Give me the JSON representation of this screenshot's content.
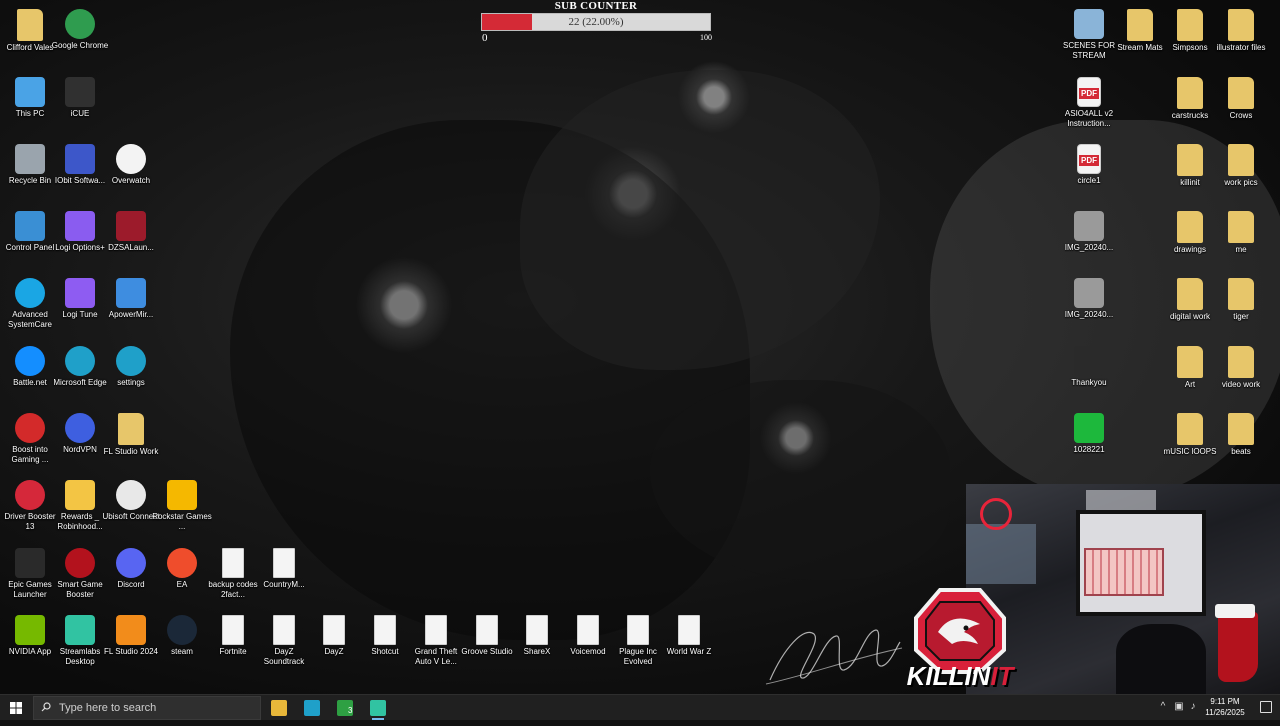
{
  "sub_counter": {
    "title": "SUB COUNTER",
    "current": 22,
    "progress_text": "22 (22.00%)",
    "progress_fraction": 0.22,
    "min_label": "0",
    "max_label": "100",
    "fill_color": "#d42a36"
  },
  "desktop": {
    "left_icons": [
      {
        "label": "Clifford Vales",
        "icon": "user-folder-icon",
        "color": "#e7c66a"
      },
      {
        "label": "Google Chrome",
        "icon": "chrome-icon",
        "color": "#2f9c4f"
      },
      {
        "label": "This PC",
        "icon": "computer-icon",
        "color": "#4aa3e6"
      },
      {
        "label": "iCUE",
        "icon": "icue-icon",
        "color": "#303030"
      },
      {
        "label": "Recycle Bin",
        "icon": "recycle-bin-icon",
        "color": "#9aa4ad"
      },
      {
        "label": "IObit Softwa...",
        "icon": "iobit-icon",
        "color": "#3d57c9"
      },
      {
        "label": "Overwatch",
        "icon": "overwatch-icon",
        "color": "#f3f3f3"
      },
      {
        "label": "Control Panel",
        "icon": "control-panel-icon",
        "color": "#3a8fd4"
      },
      {
        "label": "Logi Options+",
        "icon": "logi-options-icon",
        "color": "#8a5cf0"
      },
      {
        "label": "DZSALaun...",
        "icon": "dzsa-launcher-icon",
        "color": "#9c1b2b"
      },
      {
        "label": "Advanced SystemCare",
        "icon": "advanced-systemcare-icon",
        "color": "#1aa6e4"
      },
      {
        "label": "Logi Tune",
        "icon": "logi-tune-icon",
        "color": "#8e5cf2"
      },
      {
        "label": "ApowerMir...",
        "icon": "apowermirror-icon",
        "color": "#3e8de0"
      },
      {
        "label": "Battle.net",
        "icon": "battlenet-icon",
        "color": "#148eff"
      },
      {
        "label": "Microsoft Edge",
        "icon": "edge-icon",
        "color": "#1fa0c9"
      },
      {
        "label": "settings",
        "icon": "edge-settings-icon",
        "color": "#1fa0c9"
      },
      {
        "label": "Boost into Gaming ...",
        "icon": "boost-gaming-icon",
        "color": "#d32a2a"
      },
      {
        "label": "NordVPN",
        "icon": "nordvpn-icon",
        "color": "#3e5fe0"
      },
      {
        "label": "FL Studio Work",
        "icon": "folder-icon",
        "color": "#e7c66a"
      },
      {
        "label": "Driver Booster 13",
        "icon": "driver-booster-icon",
        "color": "#d5283a"
      },
      {
        "label": "Rewards _ Robinhood...",
        "icon": "star-icon",
        "color": "#f3c544"
      },
      {
        "label": "Ubisoft Connect",
        "icon": "ubisoft-icon",
        "color": "#e8e8e8"
      },
      {
        "label": "Rockstar Games ...",
        "icon": "rockstar-icon",
        "color": "#f5b800"
      },
      {
        "label": "Epic Games Launcher",
        "icon": "epic-games-icon",
        "color": "#2a2a2a"
      },
      {
        "label": "Smart Game Booster",
        "icon": "smart-game-booster-icon",
        "color": "#b3121d"
      },
      {
        "label": "Discord",
        "icon": "discord-icon",
        "color": "#5865f2"
      },
      {
        "label": "EA",
        "icon": "ea-icon",
        "color": "#ef4d2c"
      },
      {
        "label": "backup codes 2fact...",
        "icon": "document-icon",
        "color": "#f4f4f4"
      },
      {
        "label": "CountryM...",
        "icon": "document-icon",
        "color": "#f4f4f4"
      },
      {
        "label": "NVIDIA App",
        "icon": "nvidia-icon",
        "color": "#76b900"
      },
      {
        "label": "Streamlabs Desktop",
        "icon": "streamlabs-icon",
        "color": "#31c3a2"
      },
      {
        "label": "FL Studio 2024",
        "icon": "fl-studio-icon",
        "color": "#f28c1b"
      },
      {
        "label": "steam",
        "icon": "steam-icon",
        "color": "#1b2838"
      },
      {
        "label": "Fortnite",
        "icon": "document-icon",
        "color": "#f4f4f4"
      },
      {
        "label": "DayZ Soundtrack",
        "icon": "document-icon",
        "color": "#f4f4f4"
      },
      {
        "label": "DayZ",
        "icon": "document-icon",
        "color": "#f4f4f4"
      },
      {
        "label": "Shotcut",
        "icon": "document-icon",
        "color": "#f4f4f4"
      },
      {
        "label": "Grand Theft Auto V Le...",
        "icon": "document-icon",
        "color": "#f4f4f4"
      },
      {
        "label": "Groove Studio",
        "icon": "document-icon",
        "color": "#f4f4f4"
      },
      {
        "label": "ShareX",
        "icon": "document-icon",
        "color": "#f4f4f4"
      },
      {
        "label": "Voicemod",
        "icon": "document-icon",
        "color": "#f4f4f4"
      },
      {
        "label": "Plague Inc Evolved",
        "icon": "document-icon",
        "color": "#f4f4f4"
      },
      {
        "label": "World War Z",
        "icon": "document-icon",
        "color": "#f4f4f4"
      }
    ],
    "right_icons": [
      {
        "label": "SCENES FOR STREAM",
        "icon": "scenes-icon",
        "color": "#8ab4d8"
      },
      {
        "label": "Stream Mats",
        "icon": "folder-icon",
        "color": "#e7c66a"
      },
      {
        "label": "Simpsons",
        "icon": "folder-icon",
        "color": "#e7c66a"
      },
      {
        "label": "illustrator files",
        "icon": "folder-icon",
        "color": "#e7c66a"
      },
      {
        "label": "ASIO4ALL v2 Instruction...",
        "icon": "pdf-icon",
        "color": "#d42a36"
      },
      {
        "label": "carstrucks",
        "icon": "folder-icon",
        "color": "#e7c66a"
      },
      {
        "label": "Crows",
        "icon": "folder-icon",
        "color": "#e7c66a"
      },
      {
        "label": "circle1",
        "icon": "pdf-icon",
        "color": "#d42a36"
      },
      {
        "label": "killinit",
        "icon": "folder-icon",
        "color": "#e7c66a"
      },
      {
        "label": "work pics",
        "icon": "folder-icon",
        "color": "#e7c66a"
      },
      {
        "label": "IMG_20240...",
        "icon": "image-icon",
        "color": "#9a9a9a"
      },
      {
        "label": "drawings",
        "icon": "folder-icon",
        "color": "#e7c66a"
      },
      {
        "label": "me",
        "icon": "folder-icon",
        "color": "#e7c66a"
      },
      {
        "label": "IMG_20240...",
        "icon": "image-icon",
        "color": "#9a9a9a"
      },
      {
        "label": "digital work",
        "icon": "folder-icon",
        "color": "#e7c66a"
      },
      {
        "label": "tiger",
        "icon": "folder-icon",
        "color": "#e7c66a"
      },
      {
        "label": "Thankyou",
        "icon": "thankyou-image-icon",
        "color": "#2a2a2a"
      },
      {
        "label": "Art",
        "icon": "folder-icon",
        "color": "#e7c66a"
      },
      {
        "label": "video work",
        "icon": "folder-icon",
        "color": "#e7c66a"
      },
      {
        "label": "1028221",
        "icon": "image-icon",
        "color": "#1db83c"
      },
      {
        "label": "mUSIC lOOPS",
        "icon": "folder-icon",
        "color": "#e7c66a"
      },
      {
        "label": "beats",
        "icon": "folder-icon",
        "color": "#e7c66a"
      }
    ]
  },
  "overlay": {
    "logo_text_main": "KILLIN",
    "logo_text_accent": "IT",
    "logo_color": "#d8203a"
  },
  "taskbar": {
    "search_placeholder": "Type here to search",
    "apps": [
      {
        "name": "file-explorer-icon",
        "color": "#e8b73a"
      },
      {
        "name": "edge-icon",
        "color": "#1fa0c9"
      },
      {
        "name": "xbox-icon",
        "color": "#2ea043"
      },
      {
        "name": "streamlabs-icon",
        "color": "#31c3a2"
      }
    ],
    "xbox_badge": "3",
    "time": "9:11 PM",
    "date": "11/26/2025"
  }
}
